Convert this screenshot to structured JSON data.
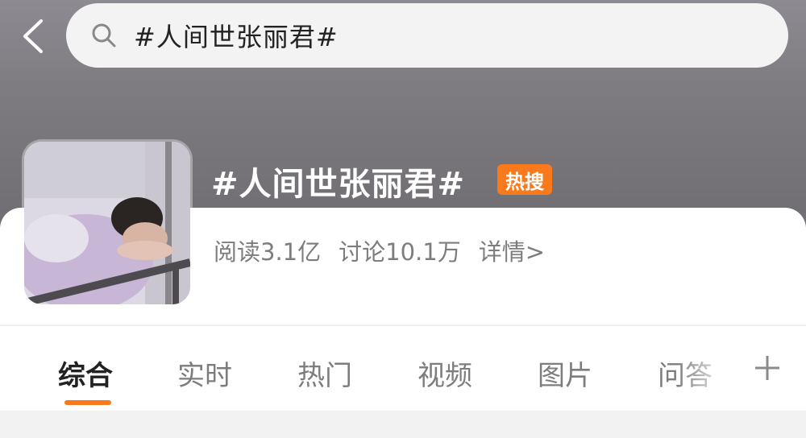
{
  "search": {
    "query": "#人间世张丽君#"
  },
  "topic": {
    "title": "#人间世张丽君#",
    "badge": "热搜",
    "reads": "阅读3.1亿",
    "discussions": "讨论10.1万",
    "details_link": "详情>"
  },
  "tabs": [
    {
      "label": "综合",
      "active": true
    },
    {
      "label": "实时",
      "active": false
    },
    {
      "label": "热门",
      "active": false
    },
    {
      "label": "视频",
      "active": false
    },
    {
      "label": "图片",
      "active": false
    },
    {
      "label": "问答",
      "active": false
    }
  ],
  "icons": {
    "back": "chevron-left-icon",
    "search": "search-icon",
    "more_tabs": "plus-icon"
  },
  "colors": {
    "accent": "#f97a1c",
    "header_bg": "#7d7b80"
  }
}
